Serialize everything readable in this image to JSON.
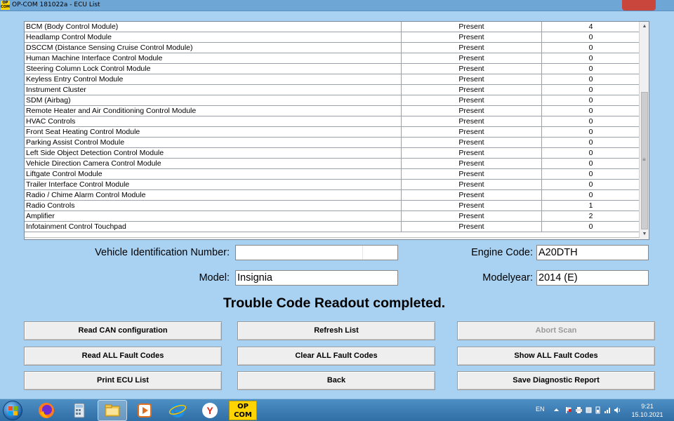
{
  "window": {
    "title": "OP-COM 181022a - ECU List",
    "icon_label": "OP COM"
  },
  "ecu_list": [
    {
      "name": "BCM (Body Control Module)",
      "status": "Present",
      "count": "4"
    },
    {
      "name": "Headlamp Control Module",
      "status": "Present",
      "count": "0"
    },
    {
      "name": "DSCCM (Distance Sensing Cruise Control Module)",
      "status": "Present",
      "count": "0"
    },
    {
      "name": "Human Machine Interface Control Module",
      "status": "Present",
      "count": "0"
    },
    {
      "name": "Steering Column Lock Control Module",
      "status": "Present",
      "count": "0"
    },
    {
      "name": "Keyless Entry Control Module",
      "status": "Present",
      "count": "0"
    },
    {
      "name": "Instrument Cluster",
      "status": "Present",
      "count": "0"
    },
    {
      "name": "SDM (Airbag)",
      "status": "Present",
      "count": "0"
    },
    {
      "name": "Remote Heater and Air Conditioning Control Module",
      "status": "Present",
      "count": "0"
    },
    {
      "name": "HVAC Controls",
      "status": "Present",
      "count": "0"
    },
    {
      "name": "Front Seat Heating Control Module",
      "status": "Present",
      "count": "0"
    },
    {
      "name": "Parking Assist Control Module",
      "status": "Present",
      "count": "0"
    },
    {
      "name": "Left Side Object Detection Control Module",
      "status": "Present",
      "count": "0"
    },
    {
      "name": "Vehicle Direction Camera Control Module",
      "status": "Present",
      "count": "0"
    },
    {
      "name": "Liftgate Control Module",
      "status": "Present",
      "count": "0"
    },
    {
      "name": "Trailer Interface Control Module",
      "status": "Present",
      "count": "0"
    },
    {
      "name": "Radio / Chime Alarm Control Module",
      "status": "Present",
      "count": "0"
    },
    {
      "name": "Radio Controls",
      "status": "Present",
      "count": "1"
    },
    {
      "name": "Amplifier",
      "status": "Present",
      "count": "2"
    },
    {
      "name": "Infotainment Control Touchpad",
      "status": "Present",
      "count": "0"
    }
  ],
  "vehicle": {
    "vin_label": "Vehicle Identification Number:",
    "vin_value": "",
    "model_label": "Model:",
    "model_value": "Insignia",
    "engine_label": "Engine Code:",
    "engine_value": "A20DTH",
    "modelyear_label": "Modelyear:",
    "modelyear_value": "2014 (E)"
  },
  "status_message": "Trouble Code Readout completed.",
  "buttons": {
    "read_can": "Read CAN configuration",
    "refresh": "Refresh List",
    "abort": "Abort Scan",
    "read_all": "Read ALL Fault Codes",
    "clear_all": "Clear ALL Fault Codes",
    "show_all": "Show ALL Fault Codes",
    "print": "Print ECU List",
    "back": "Back",
    "save": "Save Diagnostic Report"
  },
  "taskbar": {
    "opcom_label_1": "OP",
    "opcom_label_2": "COM",
    "language": "EN",
    "time": "9:21",
    "date": "15.10.2021"
  },
  "colors": {
    "background": "#a9d2f2",
    "taskbar": "#3a7cb5",
    "titlebar": "#6ea6d6",
    "close_button": "#c9463c"
  }
}
